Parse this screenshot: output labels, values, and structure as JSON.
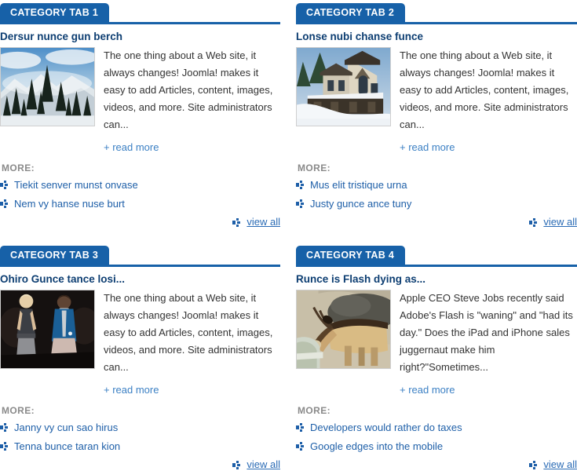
{
  "theme": {
    "tab_bg": "#1761A8",
    "rule": "#1761A8",
    "title": "#0D3E72",
    "link": "#1E5FA8",
    "readmore_link": "#3C80C4",
    "more_label": "#8A8A8A",
    "body_text": "#333333"
  },
  "common": {
    "more_label": "MORE:",
    "read_more_label": "+ read more",
    "view_all_label": "view all",
    "bullet_icon": "bullet-arrow-icon"
  },
  "panels": [
    {
      "tab_label": "CATEGORY TAB 1",
      "article": {
        "title": "Dersur nunce gun berch",
        "image_name": "snowy-mountain-pines-thumbnail",
        "intro": "The one thing about a Web site, it always changes! Joomla! makes it easy to add Articles, content, images, videos, and more. Site administrators can...",
        "read_more_label": "+ read more"
      },
      "more_label": "MORE:",
      "more_items": [
        "Tiekit senver munst onvase",
        "Nem vy hanse nuse burt"
      ],
      "view_all_label": "view all"
    },
    {
      "tab_label": "CATEGORY TAB 2",
      "article": {
        "title": "Lonse nubi chanse funce",
        "image_name": "snow-covered-victorian-house-thumbnail",
        "intro": "The one thing about a Web site, it always changes! Joomla! makes it easy to add Articles, content, images, videos, and more. Site administrators can...",
        "read_more_label": "+ read more"
      },
      "more_label": "MORE:",
      "more_items": [
        "Mus elit tristique urna",
        "Justy gunce ance tuny"
      ],
      "view_all_label": "view all"
    },
    {
      "tab_label": "CATEGORY TAB 3",
      "article": {
        "title": "Ohiro Gunce tance losi...",
        "image_name": "fashion-runway-models-thumbnail",
        "intro": "The one thing about a Web site, it always changes! Joomla! makes it easy to add Articles, content, images, videos, and more. Site administrators can...",
        "read_more_label": "+ read more"
      },
      "more_label": "MORE:",
      "more_items": [
        "Janny vy cun sao hirus",
        "Tenna bunce taran kion"
      ],
      "view_all_label": "view all"
    },
    {
      "tab_label": "CATEGORY TAB 4",
      "article": {
        "title": "Runce is Flash dying as...",
        "image_name": "goat-drinking-thumbnail",
        "intro": "Apple CEO Steve Jobs recently said Adobe's Flash is \"waning\" and \"had its day.\" Does the iPad and iPhone sales juggernaut make him right?\"Sometimes...",
        "read_more_label": "+ read more"
      },
      "more_label": "MORE:",
      "more_items": [
        "Developers would rather do taxes",
        "Google edges into the mobile"
      ],
      "view_all_label": "view all"
    }
  ]
}
